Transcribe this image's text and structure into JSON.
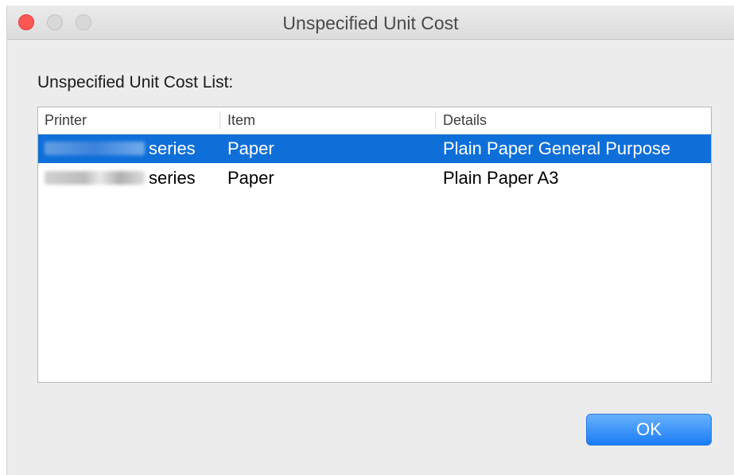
{
  "window": {
    "title": "Unspecified Unit Cost"
  },
  "list_label": "Unspecified Unit Cost List:",
  "table": {
    "columns": [
      "Printer",
      "Item",
      "Details"
    ],
    "rows": [
      {
        "printer": "series",
        "item": "Paper",
        "details": "Plain Paper General Purpose",
        "selected": true
      },
      {
        "printer": "series",
        "item": "Paper",
        "details": "Plain Paper A3",
        "selected": false
      }
    ]
  },
  "ok_label": "OK",
  "colors": {
    "accent": "#0f6fd9",
    "close": "#fc5753"
  }
}
